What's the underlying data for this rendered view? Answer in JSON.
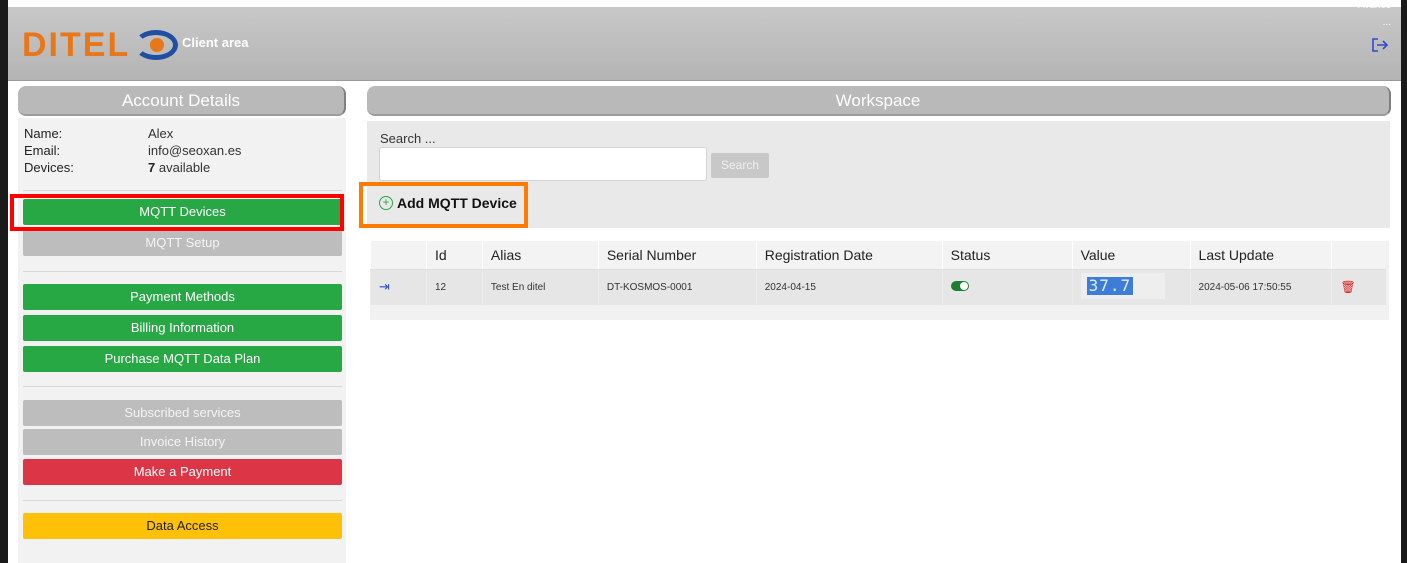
{
  "header": {
    "logo_text": "DITEL",
    "client_area": "Client area",
    "corner_label": "Avarios",
    "corner_dots": "..."
  },
  "account": {
    "title": "Account Details",
    "name_label": "Name:",
    "name_value": "Alex",
    "email_label": "Email:",
    "email_value": "info@seoxan.es",
    "devices_label": "Devices:",
    "devices_count": "7",
    "devices_suffix": "available"
  },
  "menu": {
    "mqtt_devices": "MQTT Devices",
    "mqtt_setup": "MQTT Setup",
    "payment_methods": "Payment Methods",
    "billing_information": "Billing Information",
    "purchase_plan": "Purchase MQTT Data Plan",
    "subscribed_services": "Subscribed services",
    "invoice_history": "Invoice History",
    "make_payment": "Make a Payment",
    "data_access": "Data Access"
  },
  "workspace": {
    "title": "Workspace",
    "search_label": "Search ...",
    "search_value": "",
    "search_button": "Search",
    "add_device": "Add MQTT Device"
  },
  "table": {
    "columns": [
      "",
      "Id",
      "Alias",
      "Serial Number",
      "Registration Date",
      "Status",
      "Value",
      "Last Update",
      ""
    ],
    "rows": [
      {
        "id": "12",
        "alias": "Test En ditel",
        "serial": "DT-KOSMOS-0001",
        "registration_date": "2024-04-15",
        "status_on": true,
        "value": "37.7",
        "last_update": "2024-05-06 17:50:55"
      }
    ]
  },
  "colors": {
    "brand_orange": "#e8771a",
    "brand_blue": "#1f4fa3",
    "green": "#28a745",
    "red": "#dc3545",
    "yellow": "#ffc107",
    "highlight_red": "#ff0000",
    "highlight_orange": "#ff7a00"
  }
}
